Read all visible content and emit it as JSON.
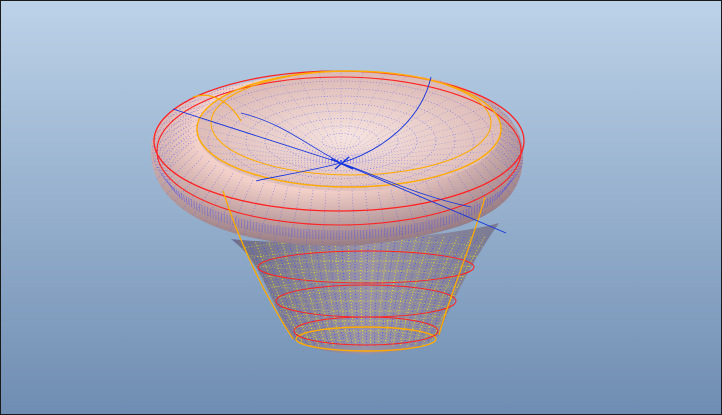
{
  "viewport": {
    "background_top": "#bcd2e8",
    "background_bottom": "#6f8db2"
  },
  "model": {
    "shape": "knob-with-toroidal-rim",
    "shading_color": "#f2cfc8",
    "shading_shadow": "#7d6470",
    "inner_shading_color": "#7a7a92",
    "mesh_line_color": "#3344ff",
    "isoparm_color": "#ffff00",
    "boundary_color_primary": "#ff2222",
    "boundary_color_secondary": "#ffaa00",
    "axis_color": "#1133dd"
  }
}
